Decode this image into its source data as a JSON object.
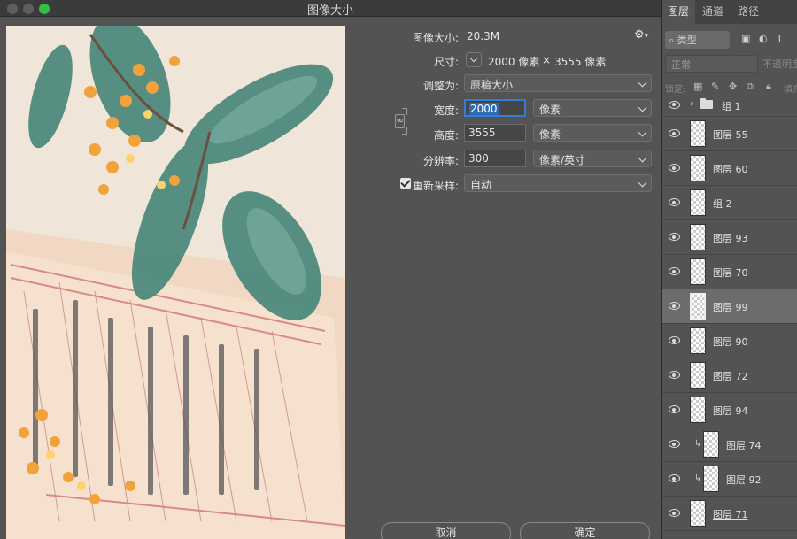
{
  "dialog": {
    "title": "图像大小",
    "image_size_label": "图像大小:",
    "image_size_value": "20.3M",
    "dimensions_label": "尺寸:",
    "dimensions_width": "2000 像素",
    "dimensions_times": "×",
    "dimensions_height": "3555 像素",
    "fit_to_label": "调整为:",
    "fit_to_value": "原稿大小",
    "width_label": "宽度:",
    "width_value": "2000",
    "width_unit": "像素",
    "height_label": "高度:",
    "height_value": "3555",
    "height_unit": "像素",
    "resolution_label": "分辨率:",
    "resolution_value": "300",
    "resolution_unit": "像素/英寸",
    "resample_label": "重新采样:",
    "resample_value": "自动",
    "resample_checked": true,
    "cancel_label": "取消",
    "ok_label": "确定"
  },
  "panel": {
    "tabs": [
      "图层",
      "通道",
      "路径"
    ],
    "active_tab": "图层",
    "filter_label": "类型",
    "blend_mode": "正常",
    "opacity_label": "不透明度",
    "lock_label": "锁定:",
    "fill_label": "填充",
    "layers": [
      {
        "name": "组 1",
        "kind": "group"
      },
      {
        "name": "图层 55",
        "kind": "layer"
      },
      {
        "name": "图层 60",
        "kind": "layer"
      },
      {
        "name": "组 2",
        "kind": "layer"
      },
      {
        "name": "图层 93",
        "kind": "layer"
      },
      {
        "name": "图层 70",
        "kind": "layer"
      },
      {
        "name": "图层 99",
        "kind": "layer",
        "selected": true
      },
      {
        "name": "图层 90",
        "kind": "layer"
      },
      {
        "name": "图层 72",
        "kind": "layer"
      },
      {
        "name": "图层 94",
        "kind": "layer"
      },
      {
        "name": "图层 74",
        "kind": "clip"
      },
      {
        "name": "图层 92",
        "kind": "clip"
      },
      {
        "name": "图层 71",
        "kind": "layer",
        "underline": true
      }
    ]
  }
}
